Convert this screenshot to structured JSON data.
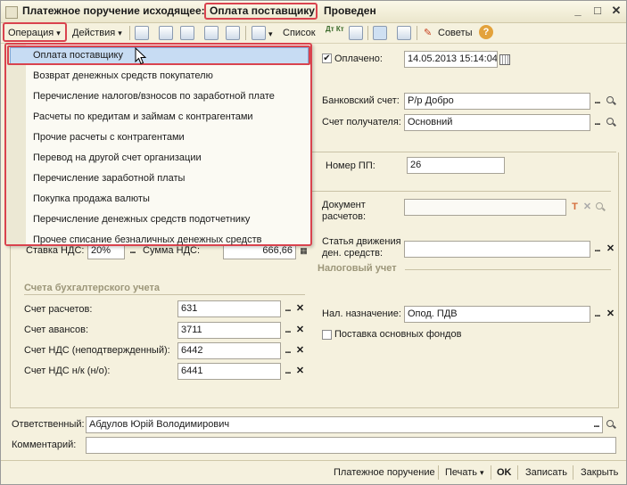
{
  "window": {
    "title_prefix": "Платежное поручение исходящее:",
    "title_operation": "Оплата поставщику",
    "title_status": "Проведен",
    "min": "_",
    "max": "□",
    "close": "✕"
  },
  "toolbar": {
    "operation": "Операция",
    "actions": "Действия",
    "list": "Список",
    "dt_kt": "Дт Кт",
    "advice": "Советы",
    "help": "?"
  },
  "operation_menu": {
    "items": [
      "Оплата поставщику",
      "Возврат денежных средств покупателю",
      "Перечисление налогов/взносов по заработной плате",
      "Расчеты по кредитам и займам с контрагентами",
      "Прочие расчеты с контрагентами",
      "Перевод на другой счет организации",
      "Перечисление заработной платы",
      "Покупка продажа валюты",
      "Перечисление денежных средств подотчетнику",
      "Прочее списание безналичных денежных средств"
    ]
  },
  "form": {
    "paid_label": "Оплачено:",
    "paid_checked": "✔",
    "paid_date": "14.05.2013 15:14:04",
    "bank_account_label": "Банковский счет:",
    "bank_account": "Р/р Добро",
    "recipient_account_label": "Счет получателя:",
    "recipient_account": "Основний",
    "pp_number_label": "Номер ПП:",
    "pp_number": "26",
    "doc_label_1": "Документ",
    "doc_label_2": "расчетов:",
    "doc_value": "",
    "movement_label_1": "Статья движения",
    "movement_label_2": "ден. средств:",
    "movement_value": "",
    "vat_rate_label": "Ставка НДС:",
    "vat_rate": "20%",
    "vat_sum_label": "Сумма НДС:",
    "vat_sum": "666,66",
    "tax_group": "Налоговый учет",
    "accounts_group": "Счета бухгалтерского учета",
    "settle_label": "Счет расчетов:",
    "settle": "631",
    "advance_label": "Счет авансов:",
    "advance": "3711",
    "vat_unconf_label": "Счет НДС (неподтвержденный):",
    "vat_unconf": "6442",
    "vat_nk_label": "Счет НДС н/к (н/о):",
    "vat_nk": "6441",
    "tax_purpose_label": "Нал. назначение:",
    "tax_purpose": "Опод. ПДВ",
    "fixed_assets_label": "Поставка основных фондов",
    "responsible_label": "Ответственный:",
    "responsible": "Абдулов Юрій Володимирович",
    "comment_label": "Комментарий:",
    "comment": ""
  },
  "statusbar": {
    "payment_order": "Платежное поручение",
    "print": "Печать",
    "ok": "OK",
    "save": "Записать",
    "close": "Закрыть"
  }
}
